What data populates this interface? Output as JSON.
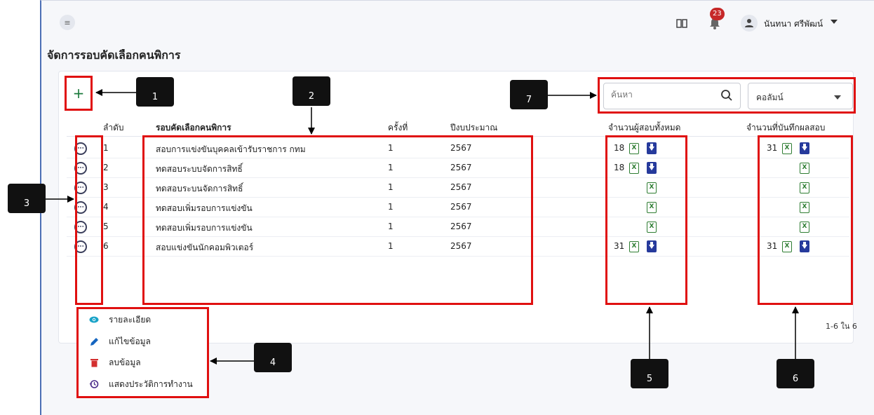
{
  "header": {
    "notification_count": "23",
    "user_name": "นันทนา ศรีพัฒน์"
  },
  "page": {
    "title": "จัดการรอบคัดเลือกคนพิการ"
  },
  "toolbar": {
    "add_label": "+",
    "search_placeholder": "ค้นหา",
    "column_select_label": "คอลัมน์"
  },
  "table": {
    "columns": [
      "ลำดับ",
      "รอบคัดเลือกคนพิการ",
      "ครั้งที่",
      "ปีงบประมาณ",
      "จำนวนผู้สอบทั้งหมด",
      "จำนวนที่บันทึกผลสอบ"
    ],
    "rows": [
      {
        "no": "1",
        "name": "สอบการแข่งขันบุคคลเข้ารับราชการ กทม",
        "round": "1",
        "year": "2567",
        "total": "18",
        "recorded": "31"
      },
      {
        "no": "2",
        "name": "ทดสอบระบบจัดการสิทธิ์",
        "round": "1",
        "year": "2567",
        "total": "18",
        "recorded": ""
      },
      {
        "no": "3",
        "name": "ทดสอบระบนจัดการสิทธิ์",
        "round": "1",
        "year": "2567",
        "total": "",
        "recorded": ""
      },
      {
        "no": "4",
        "name": "ทดสอบเพิ่มรอบการแข่งขัน",
        "round": "1",
        "year": "2567",
        "total": "",
        "recorded": ""
      },
      {
        "no": "5",
        "name": "ทดสอบเพิ่มรอบการแข่งขัน",
        "round": "1",
        "year": "2567",
        "total": "",
        "recorded": ""
      },
      {
        "no": "6",
        "name": "สอบแข่งขันนักคอมพิวเตอร์",
        "round": "1",
        "year": "2567",
        "total": "31",
        "recorded": "31"
      }
    ],
    "pagination": "1-6 ใน 6"
  },
  "row_menu": {
    "items": [
      {
        "label": "รายละเอียด",
        "icon": "eye-icon",
        "color": "#1aa3c8"
      },
      {
        "label": "แก้ไขข้อมูล",
        "icon": "pencil-icon",
        "color": "#1565c0"
      },
      {
        "label": "ลบข้อมูล",
        "icon": "trash-icon",
        "color": "#d32f2f"
      },
      {
        "label": "แสดงประวัติการทำงาน",
        "icon": "history-icon",
        "color": "#4a2c8a"
      }
    ]
  },
  "callouts": [
    "1",
    "2",
    "3",
    "4",
    "5",
    "6",
    "7"
  ],
  "colors": {
    "highlight": "#e01010",
    "add": "#1b7a3c",
    "excel": "#2e7d32",
    "download": "#263a9c"
  }
}
